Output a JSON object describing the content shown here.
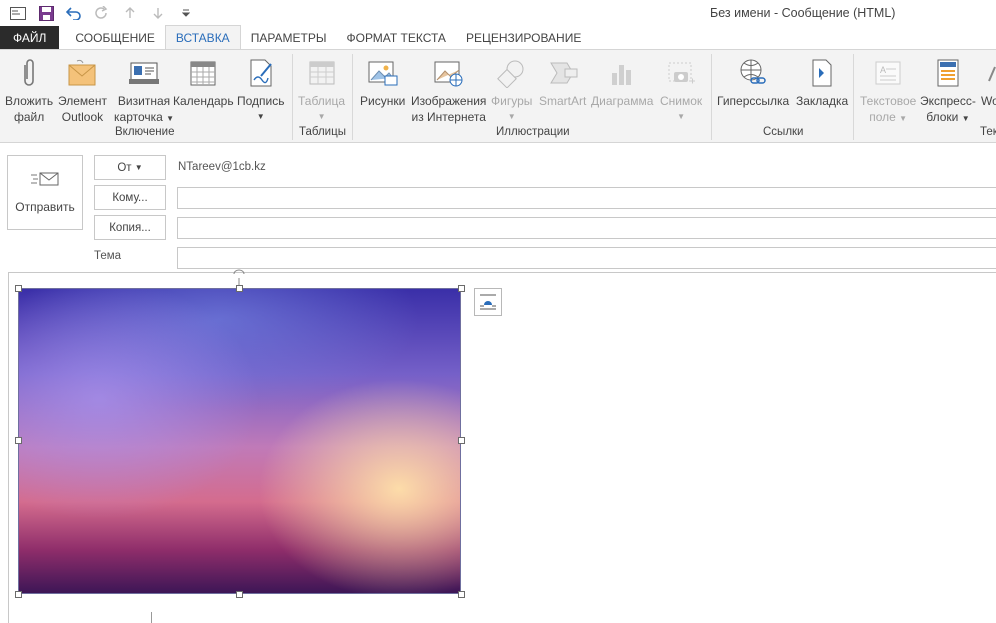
{
  "title_bar": {
    "window_title": "Без имени - Сообщение (HTML)",
    "quick_access": [
      "mail-icon",
      "save-icon",
      "undo-icon",
      "redo-icon",
      "up-arrow-icon",
      "down-arrow-icon",
      "customize-icon"
    ]
  },
  "tabs": [
    {
      "label": "ФАЙЛ"
    },
    {
      "label": "СООБЩЕНИЕ"
    },
    {
      "label": "ВСТАВКА"
    },
    {
      "label": "ПАРАМЕТРЫ"
    },
    {
      "label": "ФОРМАТ ТЕКСТА"
    },
    {
      "label": "РЕЦЕНЗИРОВАНИЕ"
    }
  ],
  "ribbon": {
    "groups": {
      "include": "Включение",
      "tables": "Таблицы",
      "illustrations": "Иллюстрации",
      "links": "Ссылки",
      "text_partial": "Тек"
    },
    "buttons": {
      "attach_file": [
        "Вложить",
        "файл"
      ],
      "outlook_item": [
        "Элемент",
        "Outlook"
      ],
      "business_card": [
        "Визитная",
        "карточка"
      ],
      "calendar": [
        "Календарь"
      ],
      "signature": [
        "Подпись"
      ],
      "table": [
        "Таблица"
      ],
      "pictures": [
        "Рисунки"
      ],
      "online_pictures": [
        "Изображения",
        "из Интернета"
      ],
      "shapes": [
        "Фигуры"
      ],
      "smartart": [
        "SmartArt"
      ],
      "chart": [
        "Диаграмма"
      ],
      "screenshot": [
        "Снимок"
      ],
      "hyperlink": [
        "Гиперссылка"
      ],
      "bookmark": [
        "Закладка"
      ],
      "text_box": [
        "Текстовое",
        "поле"
      ],
      "quick_parts": [
        "Экспресс-",
        "блоки"
      ],
      "wordart_partial": [
        "Wo"
      ]
    }
  },
  "compose": {
    "send_label": "Отправить",
    "from_label": "От",
    "from_value": "NTareev@1cb.kz",
    "to_label": "Кому...",
    "cc_label": "Копия...",
    "subject_label": "Тема",
    "to_value": "",
    "cc_value": "",
    "subject_value": ""
  }
}
